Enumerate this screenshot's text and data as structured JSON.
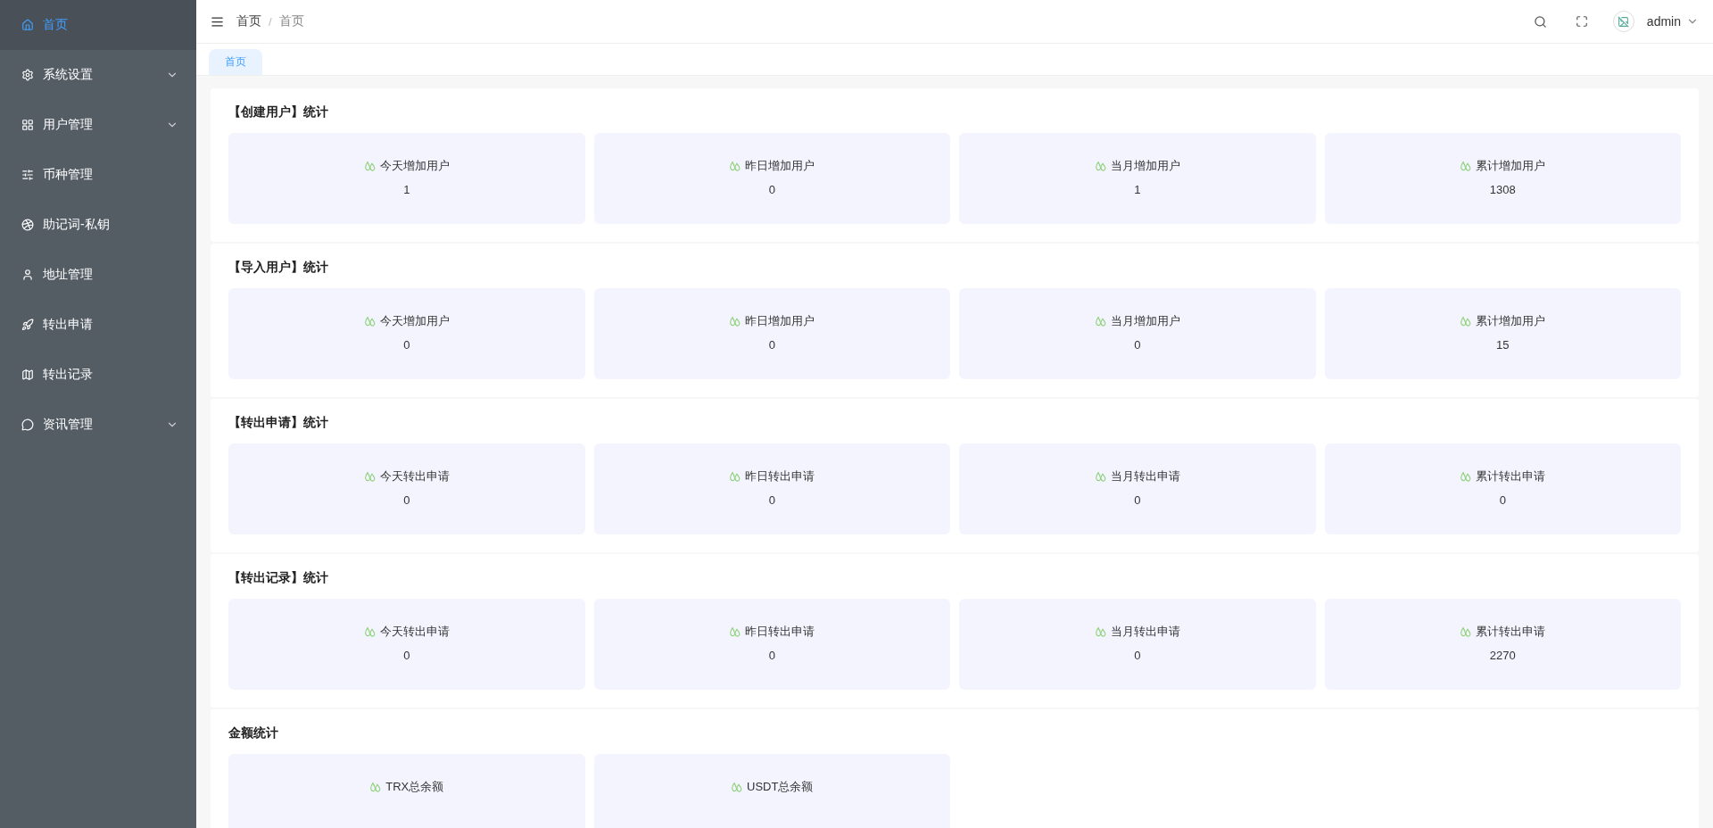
{
  "sidebar": {
    "items": [
      {
        "label": "首页",
        "kind": "home",
        "has_submenu": false,
        "selected": true
      },
      {
        "label": "系统设置",
        "kind": "gear",
        "has_submenu": true,
        "selected": false
      },
      {
        "label": "用户管理",
        "kind": "grid",
        "has_submenu": true,
        "selected": false
      },
      {
        "label": "币种管理",
        "kind": "sliders",
        "has_submenu": false,
        "selected": false
      },
      {
        "label": "助记词-私钥",
        "kind": "ball",
        "has_submenu": false,
        "selected": false
      },
      {
        "label": "地址管理",
        "kind": "user",
        "has_submenu": false,
        "selected": false
      },
      {
        "label": "转出申请",
        "kind": "rocket",
        "has_submenu": false,
        "selected": false
      },
      {
        "label": "转出记录",
        "kind": "map",
        "has_submenu": false,
        "selected": false
      },
      {
        "label": "资讯管理",
        "kind": "chat",
        "has_submenu": true,
        "selected": false
      }
    ]
  },
  "header": {
    "breadcrumbs": [
      "首页",
      "首页"
    ],
    "breadcrumb_separator": "/",
    "user": "admin"
  },
  "tabs": [
    {
      "label": "首页",
      "selected": true
    }
  ],
  "sections": [
    {
      "title": "【创建用户】统计",
      "cards": [
        {
          "label": "今天增加用户",
          "value": "1"
        },
        {
          "label": "昨日增加用户",
          "value": "0"
        },
        {
          "label": "当月增加用户",
          "value": "1"
        },
        {
          "label": "累计增加用户",
          "value": "1308"
        }
      ]
    },
    {
      "title": "【导入用户】统计",
      "cards": [
        {
          "label": "今天增加用户",
          "value": "0"
        },
        {
          "label": "昨日增加用户",
          "value": "0"
        },
        {
          "label": "当月增加用户",
          "value": "0"
        },
        {
          "label": "累计增加用户",
          "value": "15"
        }
      ]
    },
    {
      "title": "【转出申请】统计",
      "cards": [
        {
          "label": "今天转出申请",
          "value": "0"
        },
        {
          "label": "昨日转出申请",
          "value": "0"
        },
        {
          "label": "当月转出申请",
          "value": "0"
        },
        {
          "label": "累计转出申请",
          "value": "0"
        }
      ]
    },
    {
      "title": "【转出记录】统计",
      "cards": [
        {
          "label": "今天转出申请",
          "value": "0"
        },
        {
          "label": "昨日转出申请",
          "value": "0"
        },
        {
          "label": "当月转出申请",
          "value": "0"
        },
        {
          "label": "累计转出申请",
          "value": "2270"
        }
      ]
    },
    {
      "title": "金额统计",
      "cards": [
        {
          "label": "TRX总余额"
        },
        {
          "label": "USDT总余额"
        }
      ]
    }
  ]
}
